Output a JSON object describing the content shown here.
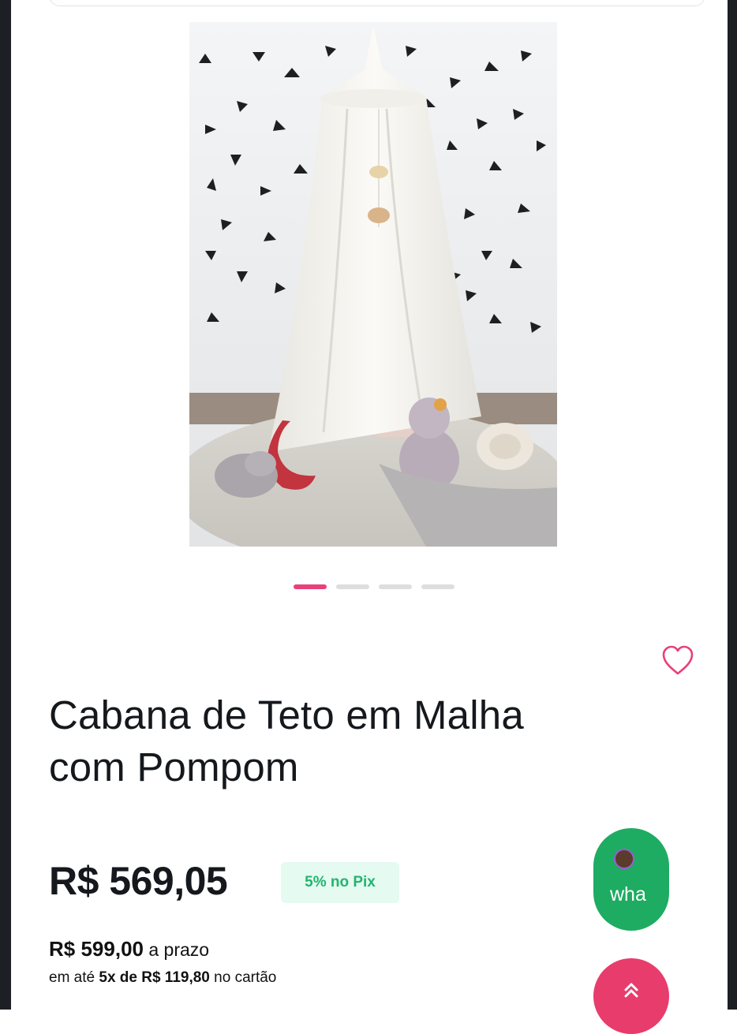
{
  "product": {
    "title_line1": "Cabana de Teto em Malha",
    "title_line2": "com Pompom",
    "price": "R$ 569,05",
    "pix_badge": "5% no Pix",
    "installment": {
      "full_price": "R$ 599,00",
      "full_price_suffix": " a prazo",
      "line2_prefix": "em até ",
      "installments": "5x de R$ 119,80",
      "line2_suffix": " no cartão"
    }
  },
  "gallery": {
    "image_count": 4,
    "active_index": 0,
    "image_icon": "canopy-photo"
  },
  "actions": {
    "favorite_icon": "heart-outline-icon",
    "whatsapp_label": "wha",
    "scroll_top_icon": "double-chevron-up-icon",
    "scroll_top_glyph": "«"
  },
  "colors": {
    "accent_pink": "#e8407a",
    "whatsapp_green": "#1dac61",
    "pix_green": "#22b56e",
    "pix_bg": "#e5faf0"
  }
}
